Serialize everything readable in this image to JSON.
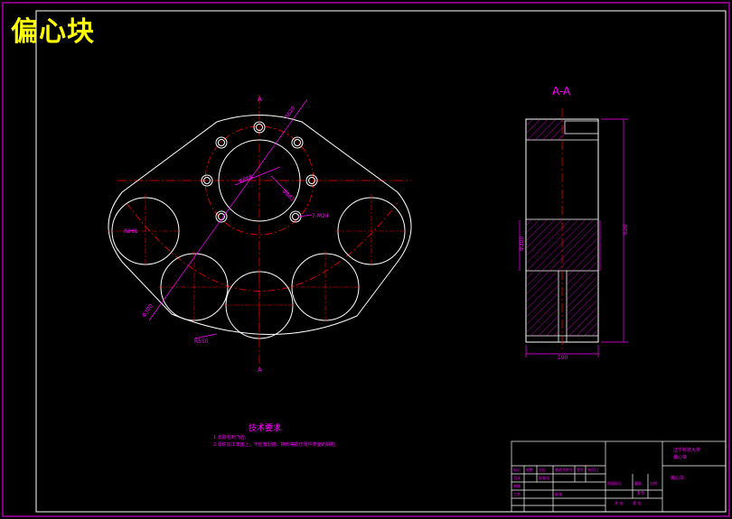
{
  "drawing": {
    "title": "偏心块",
    "section_label": "A-A",
    "tech_requirements": {
      "heading": "技术要求",
      "line1": "1.去除毛刺飞边。",
      "line2": "2.零件加工表面上，不应有划痕、擦伤等损伤零件表面的缺陷。"
    },
    "dims": {
      "top_hole": "7-M24",
      "left_circle": "R261",
      "center_circle": "Φ860",
      "bolt_circle": "Φ682",
      "big_radius": "R620",
      "bottom_radius": "R550",
      "section_height": "620",
      "section_width": "190",
      "section_left": "Φ300"
    },
    "title_block": {
      "school": "辽宁科技大学",
      "drawing_no": "偏心块",
      "part_name": "偏心块",
      "scale": "1:5",
      "labels": [
        "标记",
        "处数",
        "分区",
        "更改文件号",
        "签名",
        "年月日",
        "设计",
        "标准化",
        "阶段标记",
        "重量",
        "比例",
        "审核",
        "工艺",
        "批准",
        "共 张",
        "第 张"
      ]
    },
    "colors": {
      "border": "#ff00ff",
      "outline": "#ffffff",
      "centerline": "#ff0000",
      "dimension": "#ff00ff",
      "hatch": "#ff00ff",
      "title_text": "#ffff00"
    }
  }
}
